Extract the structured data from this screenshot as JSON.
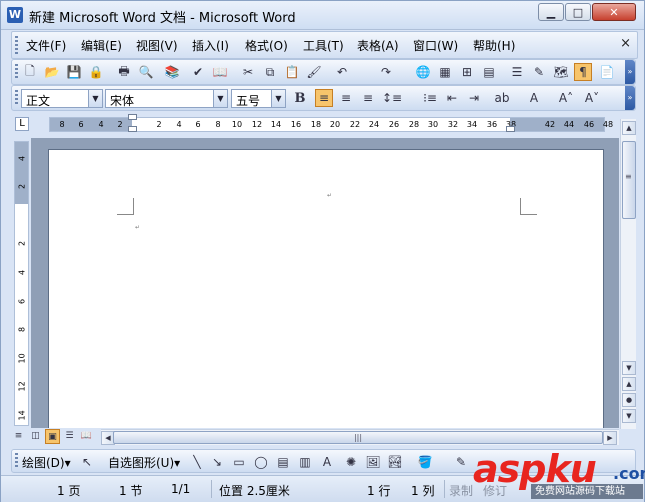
{
  "window": {
    "title": "新建 Microsoft Word 文档 - Microsoft Word",
    "app_icon_letter": "W",
    "controls": {
      "minimize": "▁",
      "maximize": "□",
      "close": "✕"
    }
  },
  "menubar": {
    "items": [
      "文件(F)",
      "编辑(E)",
      "视图(V)",
      "插入(I)",
      "格式(O)",
      "工具(T)",
      "表格(A)",
      "窗口(W)",
      "帮助(H)"
    ],
    "close_glyph": "×"
  },
  "standard_toolbar": {
    "buttons": [
      {
        "icon": "new-document-icon",
        "glyph": "🗋"
      },
      {
        "icon": "open-folder-icon",
        "glyph": "📂"
      },
      {
        "icon": "save-icon",
        "glyph": "💾"
      },
      {
        "icon": "permission-icon",
        "glyph": "🔒"
      },
      {
        "icon": "print-icon",
        "glyph": "🖶"
      },
      {
        "icon": "print-preview-icon",
        "glyph": "🔍"
      },
      {
        "icon": "research-icon",
        "glyph": "📚"
      },
      {
        "icon": "spelling-icon",
        "glyph": "✔"
      },
      {
        "icon": "research-book-icon",
        "glyph": "📖"
      },
      {
        "icon": "cut-icon",
        "glyph": "✂"
      },
      {
        "icon": "copy-icon",
        "glyph": "⧉"
      },
      {
        "icon": "paste-icon",
        "glyph": "📋"
      },
      {
        "icon": "format-painter-icon",
        "glyph": "🖌"
      },
      {
        "icon": "undo-icon",
        "glyph": "↶"
      },
      {
        "icon": "redo-icon",
        "glyph": "↷"
      },
      {
        "icon": "hyperlink-icon",
        "glyph": "🌐"
      },
      {
        "icon": "tables-borders-icon",
        "glyph": "▦"
      },
      {
        "icon": "insert-table-icon",
        "glyph": "⊞"
      },
      {
        "icon": "insert-excel-icon",
        "glyph": "▤"
      },
      {
        "icon": "columns-icon",
        "glyph": "☰"
      },
      {
        "icon": "drawing-icon",
        "glyph": "✎"
      },
      {
        "icon": "document-map-icon",
        "glyph": "🗺"
      },
      {
        "icon": "show-hide-icon",
        "glyph": "¶"
      },
      {
        "icon": "read-icon",
        "glyph": "📄"
      }
    ]
  },
  "format_toolbar": {
    "style": "正文",
    "font": "宋体",
    "size": "五号",
    "bold": "B",
    "buttons": [
      {
        "icon": "align-left-icon",
        "glyph": "≡"
      },
      {
        "icon": "align-center-icon",
        "glyph": "≡"
      },
      {
        "icon": "align-right-icon",
        "glyph": "≡"
      },
      {
        "icon": "line-spacing-icon",
        "glyph": "↕≡"
      },
      {
        "icon": "numbering-icon",
        "glyph": "⁝≡"
      },
      {
        "icon": "decrease-indent-icon",
        "glyph": "⇤"
      },
      {
        "icon": "increase-indent-icon",
        "glyph": "⇥"
      },
      {
        "icon": "highlight-icon",
        "glyph": "ab"
      },
      {
        "icon": "font-color-icon",
        "glyph": "A"
      },
      {
        "icon": "grow-font-icon",
        "glyph": "A˄"
      },
      {
        "icon": "shrink-font-icon",
        "glyph": "A˅"
      }
    ]
  },
  "ruler": {
    "corner_glyph": "L",
    "ticks": [
      "8",
      "6",
      "4",
      "2",
      "2",
      "4",
      "6",
      "8",
      "10",
      "12",
      "14",
      "16",
      "18",
      "20",
      "22",
      "24",
      "26",
      "28",
      "30",
      "32",
      "34",
      "36",
      "38",
      "42",
      "44",
      "46",
      "48"
    ]
  },
  "vertical_ruler": {
    "ticks": [
      "4",
      "2",
      "2",
      "4",
      "6",
      "8",
      "10",
      "12",
      "14"
    ]
  },
  "scrollbar": {
    "up": "▲",
    "down": "▼",
    "prev_page": "▲",
    "select_browse": "●",
    "next_page": "▼",
    "grip": "≡",
    "hgrip": "|||",
    "left": "◀",
    "right": "▶"
  },
  "view_buttons": [
    {
      "icon": "normal-view-icon",
      "glyph": "≡"
    },
    {
      "icon": "web-layout-icon",
      "glyph": "◫"
    },
    {
      "icon": "print-layout-icon",
      "glyph": "▣"
    },
    {
      "icon": "outline-view-icon",
      "glyph": "☰"
    },
    {
      "icon": "reading-layout-icon",
      "glyph": "📖"
    }
  ],
  "drawing_toolbar": {
    "draw_menu": "绘图(D)▾",
    "autoshapes": "自选图形(U)▾",
    "buttons": [
      {
        "icon": "select-pointer-icon",
        "glyph": "↖"
      },
      {
        "icon": "line-icon",
        "glyph": "╲"
      },
      {
        "icon": "arrow-icon",
        "glyph": "↘"
      },
      {
        "icon": "rectangle-icon",
        "glyph": "▭"
      },
      {
        "icon": "oval-icon",
        "glyph": "◯"
      },
      {
        "icon": "textbox-icon",
        "glyph": "▤"
      },
      {
        "icon": "vertical-textbox-icon",
        "glyph": "▥"
      },
      {
        "icon": "wordart-icon",
        "glyph": "A"
      },
      {
        "icon": "diagram-icon",
        "glyph": "✺"
      },
      {
        "icon": "clipart-icon",
        "glyph": "🖼"
      },
      {
        "icon": "picture-icon",
        "glyph": "🏞"
      },
      {
        "icon": "fill-color-icon",
        "glyph": "🪣"
      },
      {
        "icon": "line-color-icon",
        "glyph": "✎"
      }
    ]
  },
  "statusbar": {
    "page": "1 页",
    "section": "1 节",
    "pages": "1/1",
    "position": "位置 2.5厘米",
    "line": "1 行",
    "column": "1 列",
    "record": "录制",
    "revision": "修订"
  },
  "watermark": {
    "brand_a": "asp",
    "brand_b": "ku",
    "dotcom": ".com",
    "subtitle": "免费网站源码下载站"
  },
  "colors": {
    "chrome": "#d9e4f5",
    "active_button": "#f7c46b",
    "close_button": "#c7402e",
    "watermark_red": "#e8251f"
  }
}
